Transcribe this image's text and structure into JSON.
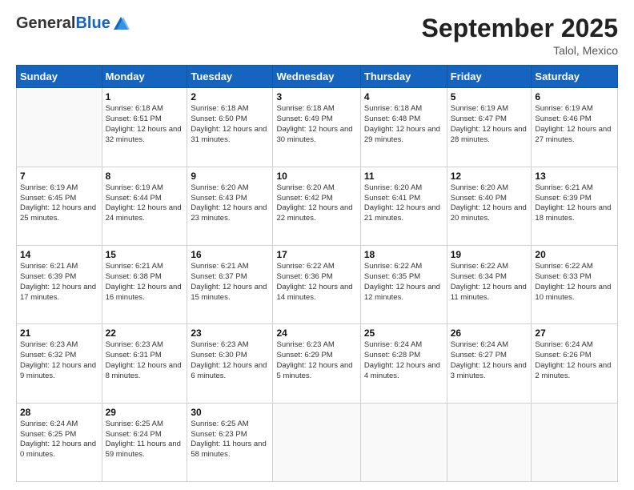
{
  "header": {
    "logo_general": "General",
    "logo_blue": "Blue",
    "month_title": "September 2025",
    "location": "Talol, Mexico"
  },
  "weekdays": [
    "Sunday",
    "Monday",
    "Tuesday",
    "Wednesday",
    "Thursday",
    "Friday",
    "Saturday"
  ],
  "weeks": [
    [
      {
        "day": "",
        "sunrise": "",
        "sunset": "",
        "daylight": ""
      },
      {
        "day": "1",
        "sunrise": "Sunrise: 6:18 AM",
        "sunset": "Sunset: 6:51 PM",
        "daylight": "Daylight: 12 hours and 32 minutes."
      },
      {
        "day": "2",
        "sunrise": "Sunrise: 6:18 AM",
        "sunset": "Sunset: 6:50 PM",
        "daylight": "Daylight: 12 hours and 31 minutes."
      },
      {
        "day": "3",
        "sunrise": "Sunrise: 6:18 AM",
        "sunset": "Sunset: 6:49 PM",
        "daylight": "Daylight: 12 hours and 30 minutes."
      },
      {
        "day": "4",
        "sunrise": "Sunrise: 6:18 AM",
        "sunset": "Sunset: 6:48 PM",
        "daylight": "Daylight: 12 hours and 29 minutes."
      },
      {
        "day": "5",
        "sunrise": "Sunrise: 6:19 AM",
        "sunset": "Sunset: 6:47 PM",
        "daylight": "Daylight: 12 hours and 28 minutes."
      },
      {
        "day": "6",
        "sunrise": "Sunrise: 6:19 AM",
        "sunset": "Sunset: 6:46 PM",
        "daylight": "Daylight: 12 hours and 27 minutes."
      }
    ],
    [
      {
        "day": "7",
        "sunrise": "Sunrise: 6:19 AM",
        "sunset": "Sunset: 6:45 PM",
        "daylight": "Daylight: 12 hours and 25 minutes."
      },
      {
        "day": "8",
        "sunrise": "Sunrise: 6:19 AM",
        "sunset": "Sunset: 6:44 PM",
        "daylight": "Daylight: 12 hours and 24 minutes."
      },
      {
        "day": "9",
        "sunrise": "Sunrise: 6:20 AM",
        "sunset": "Sunset: 6:43 PM",
        "daylight": "Daylight: 12 hours and 23 minutes."
      },
      {
        "day": "10",
        "sunrise": "Sunrise: 6:20 AM",
        "sunset": "Sunset: 6:42 PM",
        "daylight": "Daylight: 12 hours and 22 minutes."
      },
      {
        "day": "11",
        "sunrise": "Sunrise: 6:20 AM",
        "sunset": "Sunset: 6:41 PM",
        "daylight": "Daylight: 12 hours and 21 minutes."
      },
      {
        "day": "12",
        "sunrise": "Sunrise: 6:20 AM",
        "sunset": "Sunset: 6:40 PM",
        "daylight": "Daylight: 12 hours and 20 minutes."
      },
      {
        "day": "13",
        "sunrise": "Sunrise: 6:21 AM",
        "sunset": "Sunset: 6:39 PM",
        "daylight": "Daylight: 12 hours and 18 minutes."
      }
    ],
    [
      {
        "day": "14",
        "sunrise": "Sunrise: 6:21 AM",
        "sunset": "Sunset: 6:39 PM",
        "daylight": "Daylight: 12 hours and 17 minutes."
      },
      {
        "day": "15",
        "sunrise": "Sunrise: 6:21 AM",
        "sunset": "Sunset: 6:38 PM",
        "daylight": "Daylight: 12 hours and 16 minutes."
      },
      {
        "day": "16",
        "sunrise": "Sunrise: 6:21 AM",
        "sunset": "Sunset: 6:37 PM",
        "daylight": "Daylight: 12 hours and 15 minutes."
      },
      {
        "day": "17",
        "sunrise": "Sunrise: 6:22 AM",
        "sunset": "Sunset: 6:36 PM",
        "daylight": "Daylight: 12 hours and 14 minutes."
      },
      {
        "day": "18",
        "sunrise": "Sunrise: 6:22 AM",
        "sunset": "Sunset: 6:35 PM",
        "daylight": "Daylight: 12 hours and 12 minutes."
      },
      {
        "day": "19",
        "sunrise": "Sunrise: 6:22 AM",
        "sunset": "Sunset: 6:34 PM",
        "daylight": "Daylight: 12 hours and 11 minutes."
      },
      {
        "day": "20",
        "sunrise": "Sunrise: 6:22 AM",
        "sunset": "Sunset: 6:33 PM",
        "daylight": "Daylight: 12 hours and 10 minutes."
      }
    ],
    [
      {
        "day": "21",
        "sunrise": "Sunrise: 6:23 AM",
        "sunset": "Sunset: 6:32 PM",
        "daylight": "Daylight: 12 hours and 9 minutes."
      },
      {
        "day": "22",
        "sunrise": "Sunrise: 6:23 AM",
        "sunset": "Sunset: 6:31 PM",
        "daylight": "Daylight: 12 hours and 8 minutes."
      },
      {
        "day": "23",
        "sunrise": "Sunrise: 6:23 AM",
        "sunset": "Sunset: 6:30 PM",
        "daylight": "Daylight: 12 hours and 6 minutes."
      },
      {
        "day": "24",
        "sunrise": "Sunrise: 6:23 AM",
        "sunset": "Sunset: 6:29 PM",
        "daylight": "Daylight: 12 hours and 5 minutes."
      },
      {
        "day": "25",
        "sunrise": "Sunrise: 6:24 AM",
        "sunset": "Sunset: 6:28 PM",
        "daylight": "Daylight: 12 hours and 4 minutes."
      },
      {
        "day": "26",
        "sunrise": "Sunrise: 6:24 AM",
        "sunset": "Sunset: 6:27 PM",
        "daylight": "Daylight: 12 hours and 3 minutes."
      },
      {
        "day": "27",
        "sunrise": "Sunrise: 6:24 AM",
        "sunset": "Sunset: 6:26 PM",
        "daylight": "Daylight: 12 hours and 2 minutes."
      }
    ],
    [
      {
        "day": "28",
        "sunrise": "Sunrise: 6:24 AM",
        "sunset": "Sunset: 6:25 PM",
        "daylight": "Daylight: 12 hours and 0 minutes."
      },
      {
        "day": "29",
        "sunrise": "Sunrise: 6:25 AM",
        "sunset": "Sunset: 6:24 PM",
        "daylight": "Daylight: 11 hours and 59 minutes."
      },
      {
        "day": "30",
        "sunrise": "Sunrise: 6:25 AM",
        "sunset": "Sunset: 6:23 PM",
        "daylight": "Daylight: 11 hours and 58 minutes."
      },
      {
        "day": "",
        "sunrise": "",
        "sunset": "",
        "daylight": ""
      },
      {
        "day": "",
        "sunrise": "",
        "sunset": "",
        "daylight": ""
      },
      {
        "day": "",
        "sunrise": "",
        "sunset": "",
        "daylight": ""
      },
      {
        "day": "",
        "sunrise": "",
        "sunset": "",
        "daylight": ""
      }
    ]
  ]
}
